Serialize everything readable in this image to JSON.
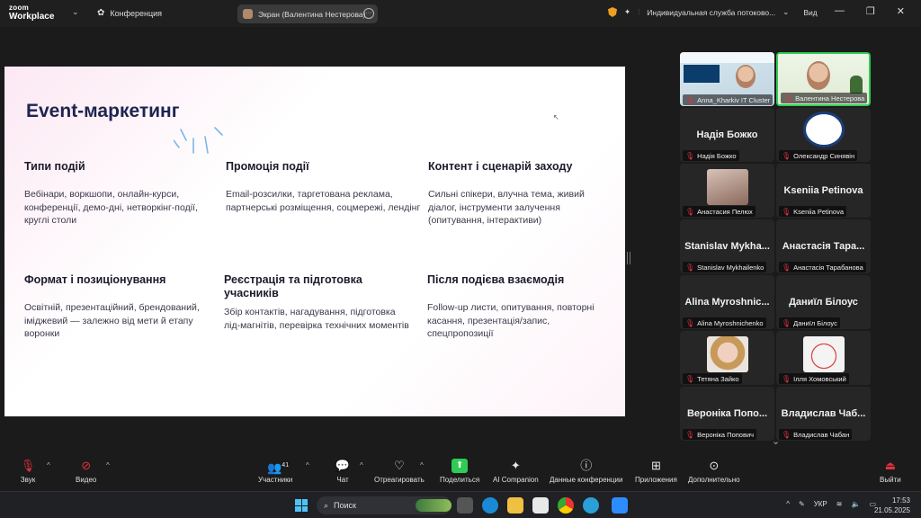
{
  "topbar": {
    "logo_line1": "zoom",
    "logo_line2": "Workplace",
    "meeting_label": "Конференция",
    "screen_share_label": "Экран (Валентина Нестерова)",
    "service_label": "Индивидуальная служба потоково...",
    "view_label": "Вид"
  },
  "slide": {
    "title": "Event-маркетинг",
    "blocks": [
      {
        "heading": "Типи подій",
        "text": "Вебінари, воркшопи, онлайн-курси, конференції, демо-дні, нетворкінг-події, круглі столи"
      },
      {
        "heading": "Промоція події",
        "text": "Email-розсилки, таргетована реклама, партнерські розміщення, соцмережі, лендінг"
      },
      {
        "heading": "Контент і сценарій заходу",
        "text": "Сильні спікери, влучна тема, живий діалог, інструменти залучення (опитування, інтерактиви)"
      },
      {
        "heading": "Формат і позиціонування",
        "text": "Освітній, презентаційний, брендований, іміджевий — залежно від мети й етапу воронки"
      },
      {
        "heading": "Реєстрація та підготовка учасників",
        "text": "Збір контактів, нагадування, підготовка лід-магнітів, перевірка технічних моментів"
      },
      {
        "heading": "Після подієва взаємодія",
        "text": "Follow-up листи, опитування, повторні касання, презентація/запис, спецпропозиції"
      }
    ]
  },
  "participants": [
    {
      "display": "",
      "caption": "Anna_Kharkiv IT Cluster",
      "kind": "video"
    },
    {
      "display": "",
      "caption": "Валентина Нестерова",
      "kind": "video-active"
    },
    {
      "display": "Надія Божко",
      "caption": "Надія Божко",
      "kind": "name"
    },
    {
      "display": "",
      "caption": "Олександр Синявін",
      "kind": "logo"
    },
    {
      "display": "",
      "caption": "Анастасия Пелюх",
      "kind": "photo"
    },
    {
      "display": "Ksenіia Petinova",
      "caption": "Ksenіia Petinova",
      "kind": "name"
    },
    {
      "display": "Stanislav Mykha...",
      "caption": "Stanislav Mykhailenko",
      "kind": "name"
    },
    {
      "display": "Анастасія Тара...",
      "caption": "Анастасія Тарабанова",
      "kind": "name"
    },
    {
      "display": "Alina Myroshnic...",
      "caption": "Alina Myroshnichenko",
      "kind": "name"
    },
    {
      "display": "Даниїл Білоус",
      "caption": "Даниїл Білоус",
      "kind": "name"
    },
    {
      "display": "",
      "caption": "Тетяна Зайко",
      "kind": "photo2"
    },
    {
      "display": "",
      "caption": "Ілля Хомовський",
      "kind": "photo3"
    },
    {
      "display": "Вероніка Попо...",
      "caption": "Вероніка Попович",
      "kind": "name"
    },
    {
      "display": "Владислав Чаб...",
      "caption": "Владислав Чабан",
      "kind": "name"
    }
  ],
  "toolbar": {
    "audio": "Звук",
    "video": "Видео",
    "participants": "Участники",
    "participants_count": "41",
    "chat": "Чат",
    "react": "Отреагировать",
    "share": "Поделиться",
    "ai": "AI Companion",
    "info": "Данные конференции",
    "apps": "Приложения",
    "more": "Дополнительно",
    "leave": "Выйти"
  },
  "taskbar": {
    "search_placeholder": "Поиск",
    "lang": "УКР",
    "time": "17:53",
    "date": "21.05.2025"
  }
}
